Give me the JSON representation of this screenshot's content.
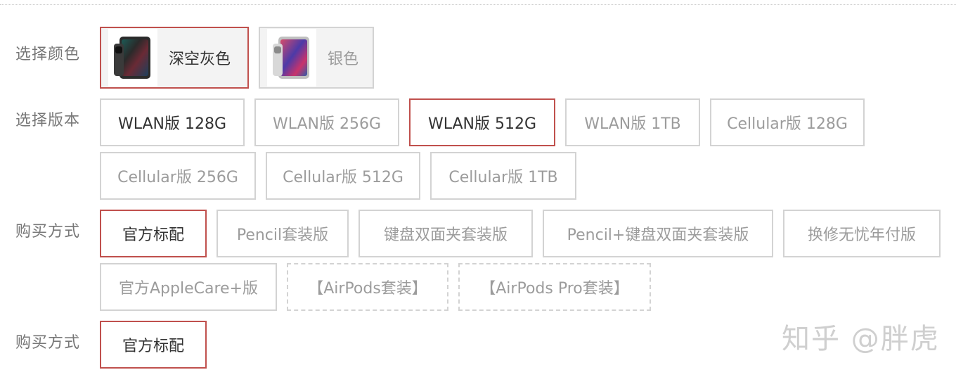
{
  "rows": {
    "color": {
      "label": "选择颜色",
      "options": [
        {
          "label": "深空灰色",
          "selected": true,
          "icon": "ipad-space-gray-thumbnail"
        },
        {
          "label": "银色",
          "selected": false,
          "icon": "ipad-silver-thumbnail"
        }
      ]
    },
    "version": {
      "label": "选择版本",
      "options": [
        {
          "label": "WLAN版 128G",
          "selected": false
        },
        {
          "label": "WLAN版 256G",
          "selected": false
        },
        {
          "label": "WLAN版 512G",
          "selected": true
        },
        {
          "label": "WLAN版 1TB",
          "selected": false
        },
        {
          "label": "Cellular版 128G",
          "selected": false
        },
        {
          "label": "Cellular版 256G",
          "selected": false
        },
        {
          "label": "Cellular版 512G",
          "selected": false
        },
        {
          "label": "Cellular版 1TB",
          "selected": false
        }
      ]
    },
    "purchase": {
      "label": "购买方式",
      "options": [
        {
          "label": "官方标配",
          "selected": true
        },
        {
          "label": "Pencil套装版",
          "selected": false
        },
        {
          "label": "键盘双面夹套装版",
          "selected": false
        },
        {
          "label": "Pencil+键盘双面夹套装版",
          "selected": false
        },
        {
          "label": "换修无忧年付版",
          "selected": false
        },
        {
          "label": "官方AppleCare+版",
          "selected": false
        },
        {
          "label": "【AirPods套装】",
          "selected": false,
          "dashed": true
        },
        {
          "label": "【AirPods Pro套装】",
          "selected": false,
          "dashed": true
        }
      ]
    },
    "purchase2": {
      "label": "购买方式",
      "options": [
        {
          "label": "官方标配",
          "selected": true
        }
      ]
    }
  },
  "watermark": "知乎 @胖虎",
  "colors": {
    "selected_border": "#c0504d",
    "default_border": "#d3d3d3",
    "label_text": "#777777",
    "inactive_text": "#9c9c9c",
    "active_text": "#333333"
  }
}
